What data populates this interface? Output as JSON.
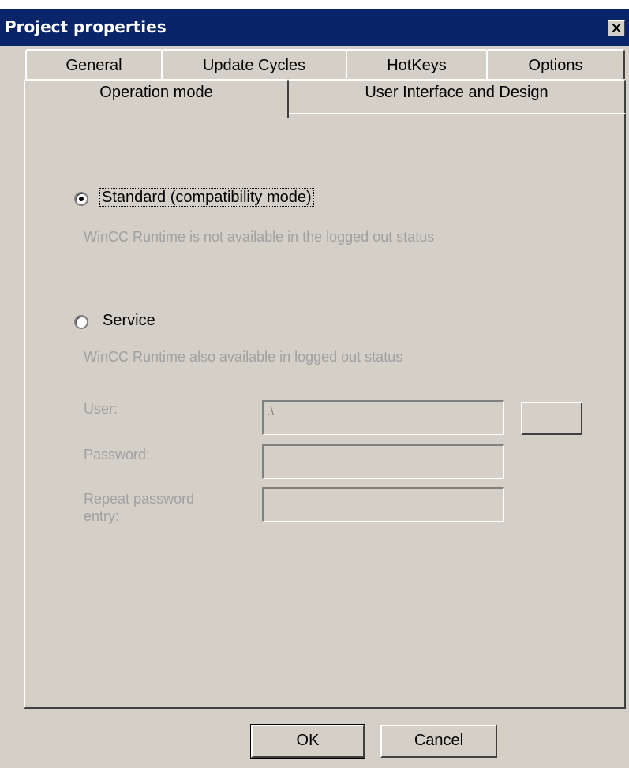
{
  "window": {
    "title": "Project properties",
    "close_icon": "close-icon"
  },
  "tabs": {
    "row1": [
      {
        "label": "General"
      },
      {
        "label": "Update Cycles"
      },
      {
        "label": "HotKeys"
      },
      {
        "label": "Options"
      }
    ],
    "row2": [
      {
        "label": "Operation mode",
        "active": true
      },
      {
        "label": "User Interface and Design"
      }
    ]
  },
  "operation_mode": {
    "standard": {
      "label": "Standard  (compatibility mode)",
      "selected": true,
      "description": "WinCC Runtime is not available in the logged out status"
    },
    "service": {
      "label": "Service",
      "selected": false,
      "description": "WinCC Runtime also available in logged out status"
    },
    "user": {
      "label": "User:",
      "value": ".\\",
      "browse_label": "..."
    },
    "password": {
      "label": "Password:",
      "value": ""
    },
    "repeat_password": {
      "label": "Repeat password entry:",
      "value": ""
    }
  },
  "buttons": {
    "ok": "OK",
    "cancel": "Cancel"
  }
}
